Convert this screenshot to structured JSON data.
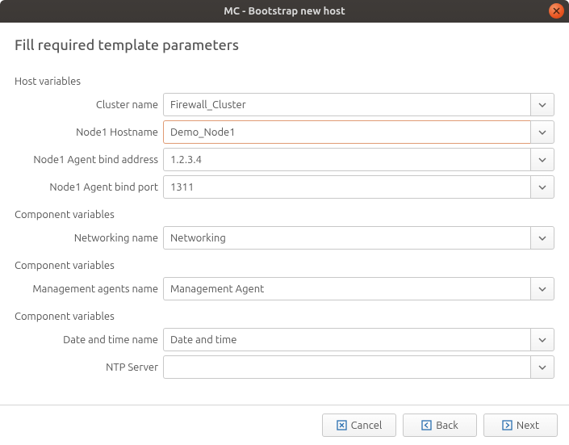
{
  "window_title": "MC - Bootstrap new host",
  "heading": "Fill required template parameters",
  "sections": {
    "host": {
      "title": "Host variables",
      "fields": {
        "cluster_name": {
          "label": "Cluster name",
          "value": "Firewall_Cluster"
        },
        "node1_hostname": {
          "label": "Node1 Hostname",
          "value": "Demo_Node1"
        },
        "node1_bind_addr": {
          "label": "Node1 Agent bind address",
          "value": "1.2.3.4"
        },
        "node1_bind_port": {
          "label": "Node1 Agent bind port",
          "value": "1311"
        }
      }
    },
    "comp1": {
      "title": "Component variables",
      "fields": {
        "networking_name": {
          "label": "Networking name",
          "value": "Networking"
        }
      }
    },
    "comp2": {
      "title": "Component variables",
      "fields": {
        "mgmt_agents_name": {
          "label": "Management agents name",
          "value": "Management Agent"
        }
      }
    },
    "comp3": {
      "title": "Component variables",
      "fields": {
        "date_time_name": {
          "label": "Date and time name",
          "value": "Date and time"
        },
        "ntp_server": {
          "label": "NTP Server",
          "value": ""
        }
      }
    }
  },
  "buttons": {
    "cancel": "Cancel",
    "back": "Back",
    "next": "Next"
  }
}
